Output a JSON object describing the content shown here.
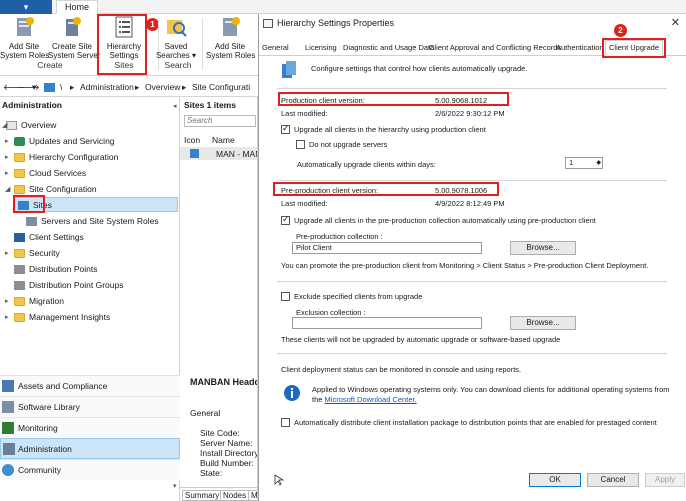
{
  "ribbon": {
    "file_tab": "",
    "home_tab": "Home",
    "buttons": [
      {
        "label": "Add Site\nSystem Roles"
      },
      {
        "label": "Create Site\nSystem Server"
      },
      {
        "label": "Hierarchy\nSettings"
      },
      {
        "label": "Saved\nSearches ▾"
      },
      {
        "label": "Add Site\nSystem Roles"
      }
    ],
    "groups": {
      "create": "Create",
      "sites": "Sites",
      "search": "Search"
    },
    "badge1": "1"
  },
  "address": {
    "p1": "\\",
    "p2": "Administration",
    "p3": "Overview",
    "p4": "Site Configurati"
  },
  "nav": {
    "title": "Administration",
    "items": {
      "overview": "Overview",
      "updates": "Updates and Servicing",
      "hierarchy": "Hierarchy Configuration",
      "cloud": "Cloud Services",
      "siteconfig": "Site Configuration",
      "sites": "Sites",
      "servers": "Servers and Site System Roles",
      "clientsettings": "Client Settings",
      "security": "Security",
      "dp": "Distribution Points",
      "dpg": "Distribution Point Groups",
      "migration": "Migration",
      "mgmt": "Management Insights"
    },
    "workspaces": {
      "assets": "Assets and Compliance",
      "library": "Software Library",
      "monitoring": "Monitoring",
      "admin": "Administration",
      "community": "Community"
    }
  },
  "mid": {
    "header": "Sites 1 items",
    "search_placeholder": "Search",
    "col_icon": "Icon",
    "col_name": "Name",
    "row_name": "MAN - MAN",
    "detail_title": "MANBAN Headqu",
    "general": "General",
    "kv": [
      "Site Code:",
      "Server Name:",
      "Install Directory:",
      "Build Number:",
      "State:"
    ],
    "tabs": [
      "Summary",
      "Nodes",
      "M"
    ]
  },
  "dialog": {
    "title": "Hierarchy Settings Properties",
    "close": "✕",
    "badge2": "2",
    "tabs": [
      "General",
      "Licensing",
      "Diagnostic and Usage Data",
      "Client Approval and Conflicting Records",
      "Authentication",
      "Client Upgrade"
    ],
    "intro": "Configure settings that control how clients automatically upgrade.",
    "prod_label": "Production client version:",
    "prod_value": "5.00.9068.1012",
    "prod_mod_label": "Last modified:",
    "prod_mod_value": "2/6/2022 9:30:12 PM",
    "upgrade_all": "Upgrade all clients in the hierarchy using production client",
    "no_servers": "Do not upgrade servers",
    "within_days": "Automatically upgrade clients within days:",
    "days_value": "1",
    "pre_label": "Pre-production client version:",
    "pre_value": "5.00.9078.1006",
    "pre_mod_label": "Last modified:",
    "pre_mod_value": "4/9/2022 8:12:49 PM",
    "upgrade_pre": "Upgrade all clients in the pre-production collection automatically using pre-production client",
    "pre_collection_label": "Pre-production collection :",
    "pre_collection_value": "Pilot Client",
    "browse": "Browse...",
    "promote_note": "You can promote the pre-production client from Monitoring > Client Status > Pre-production Client Deployment.",
    "exclude": "Exclude specified clients from upgrade",
    "exclusion_label": "Exclusion collection :",
    "exclusion_value": "",
    "exclude_note": "These clients will not be upgraded by automatic upgrade or software-based upgrade",
    "status_note": "Client deployment status can be monitored in console and using reports.",
    "info_text": "Applied to Windows operating systems only. You can download clients for additional operating systems from",
    "info_text2": "the",
    "info_link": "Microsoft Download Center.",
    "prestage": "Automatically distribute client installation package to distribution points that are enabled for prestaged content",
    "ok": "OK",
    "cancel": "Cancel",
    "apply": "Apply"
  }
}
